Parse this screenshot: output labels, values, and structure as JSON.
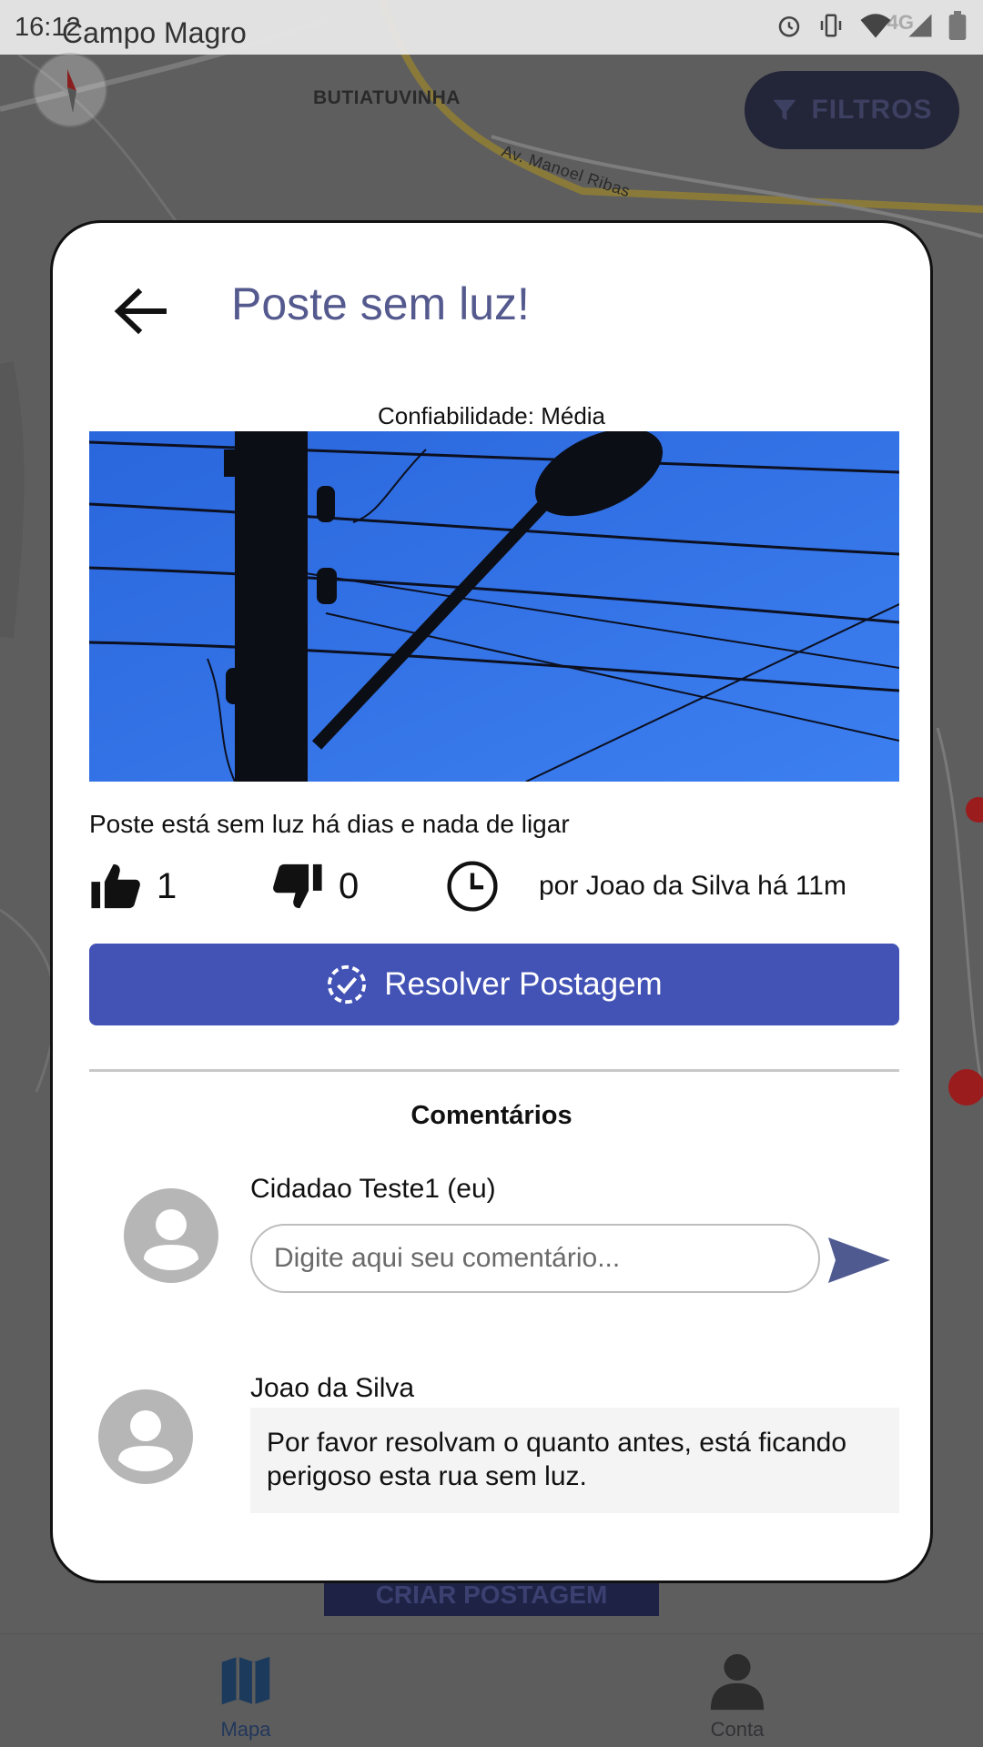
{
  "status_bar": {
    "time": "16:12",
    "location_overlay": "Campo Magro",
    "network": "4G"
  },
  "map": {
    "labels": {
      "neighborhood": "BUTIATUVINHA",
      "street": "Av. Manoel Ribas"
    },
    "filter_button": "FILTROS",
    "create_button": "CRIAR POSTAGEM"
  },
  "post": {
    "title": "Poste sem luz!",
    "reliability": "Confiabilidade: Média",
    "description": "Poste está sem luz há dias e nada de ligar",
    "likes": "1",
    "dislikes": "0",
    "author_time": "por Joao da Silva há 11m",
    "resolve_button": "Resolver Postagem"
  },
  "comments": {
    "title": "Comentários",
    "current_user": "Cidadao Teste1 (eu)",
    "input_placeholder": "Digite aqui seu comentário...",
    "items": [
      {
        "author": "Joao da Silva",
        "text": "Por favor resolvam o quanto antes, está ficando perigoso esta rua sem luz."
      }
    ]
  },
  "bottom_nav": {
    "items": [
      {
        "label": "Mapa",
        "icon": "map-icon",
        "active": true
      },
      {
        "label": "Conta",
        "icon": "account-icon",
        "active": false
      }
    ]
  },
  "colors": {
    "primary": "#4252b5",
    "title": "#555a8e",
    "send": "#4f5a91",
    "photo_sky": "#2f6fe0"
  }
}
